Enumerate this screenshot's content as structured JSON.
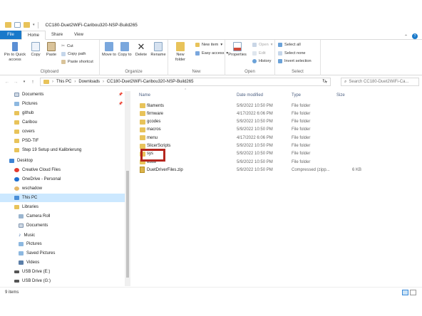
{
  "window": {
    "title": "CC180-Duet2WiFi-Caribou320-NSP-Build265"
  },
  "tabs": [
    {
      "label": "File"
    },
    {
      "label": "Home"
    },
    {
      "label": "Share"
    },
    {
      "label": "View"
    }
  ],
  "ribbon": {
    "clipboard": {
      "label": "Clipboard",
      "pin": "Pin to Quick access",
      "copy": "Copy",
      "paste": "Paste",
      "cut": "Cut",
      "copy_path": "Copy path",
      "paste_shortcut": "Paste shortcut"
    },
    "organize": {
      "label": "Organize",
      "move_to": "Move to",
      "copy_to": "Copy to",
      "delete": "Delete",
      "rename": "Rename"
    },
    "new": {
      "label": "New",
      "new_folder": "New folder",
      "new_item": "New item",
      "easy_access": "Easy access"
    },
    "open": {
      "label": "Open",
      "properties": "Properties",
      "open": "Open",
      "edit": "Edit",
      "history": "History"
    },
    "select": {
      "label": "Select",
      "select_all": "Select all",
      "select_none": "Select none",
      "invert": "Invert selection"
    }
  },
  "address": {
    "segments": [
      "This PC",
      "Downloads",
      "CC180-Duet2WiFi-Caribou320-NSP-Build265"
    ],
    "search_placeholder": "Search CC180-Duet2WiFi-Ca..."
  },
  "nav": {
    "quick": [
      "Documents",
      "Pictures",
      "github",
      "Caribou",
      "covers",
      "PSD-TIF",
      "Step 19 Setup und Kalibrierung"
    ],
    "desktop": "Desktop",
    "desktop_items": [
      "Creative Cloud Files",
      "OneDrive - Personal",
      "wschadow",
      "This PC",
      "Libraries"
    ],
    "libraries": [
      "Camera Roll",
      "Documents",
      "Music",
      "Pictures",
      "Saved Pictures",
      "Videos"
    ],
    "drives": [
      "USB Drive (E:)",
      "USB Drive (G:)"
    ]
  },
  "columns": {
    "name": "Name",
    "date": "Date modified",
    "type": "Type",
    "size": "Size"
  },
  "files": [
    {
      "name": "filaments",
      "date": "5/9/2022 10:50 PM",
      "type": "File folder",
      "size": ""
    },
    {
      "name": "firmware",
      "date": "4/17/2022 6:06 PM",
      "type": "File folder",
      "size": ""
    },
    {
      "name": "gcodes",
      "date": "5/9/2022 10:50 PM",
      "type": "File folder",
      "size": ""
    },
    {
      "name": "macros",
      "date": "5/9/2022 10:50 PM",
      "type": "File folder",
      "size": ""
    },
    {
      "name": "menu",
      "date": "4/17/2022 6:06 PM",
      "type": "File folder",
      "size": ""
    },
    {
      "name": "SlicerScripts",
      "date": "5/9/2022 10:50 PM",
      "type": "File folder",
      "size": ""
    },
    {
      "name": "sys",
      "date": "5/9/2022 10:50 PM",
      "type": "File folder",
      "size": ""
    },
    {
      "name": "www",
      "date": "5/9/2022 10:50 PM",
      "type": "File folder",
      "size": ""
    },
    {
      "name": "DuetDriverFiles.zip",
      "date": "5/9/2022 10:50 PM",
      "type": "Compressed (zipp...",
      "size": "6 KB"
    }
  ],
  "status": {
    "count": "9 items"
  },
  "colors": {
    "accent": "#1979ca",
    "highlight": "#b5261e",
    "folder": "#e8c35a"
  }
}
